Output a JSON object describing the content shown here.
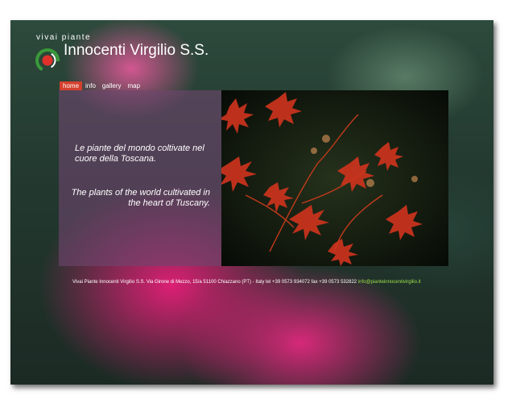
{
  "brand": {
    "tagline": "vivai piante",
    "name": "Innocenti Virgilio S.S."
  },
  "nav": {
    "items": [
      {
        "label": "home",
        "active": true
      },
      {
        "label": "info",
        "active": false
      },
      {
        "label": "gallery",
        "active": false
      },
      {
        "label": "map",
        "active": false
      }
    ]
  },
  "hero": {
    "text_it": "Le piante del mondo coltivate nel cuore della Toscana.",
    "text_en": "The plants of the world cultivated in the heart of Tuscany."
  },
  "footer": {
    "address": "Vivai Piante Innocenti Virgilio S.S. Via Girone di Mezzo, 15/a 51100 Chiazzano (PT) - Italy tel +39 0573 934072 fax +39 0573 532822",
    "email": "info@pianteinnocentivirgilio.it"
  },
  "colors": {
    "nav_active": "#d4402e",
    "logo_red": "#e0312b",
    "logo_green": "#3a9a3a",
    "panel_overlay": "rgba(110,70,110,0.62)",
    "email_link": "#9fe04a"
  }
}
